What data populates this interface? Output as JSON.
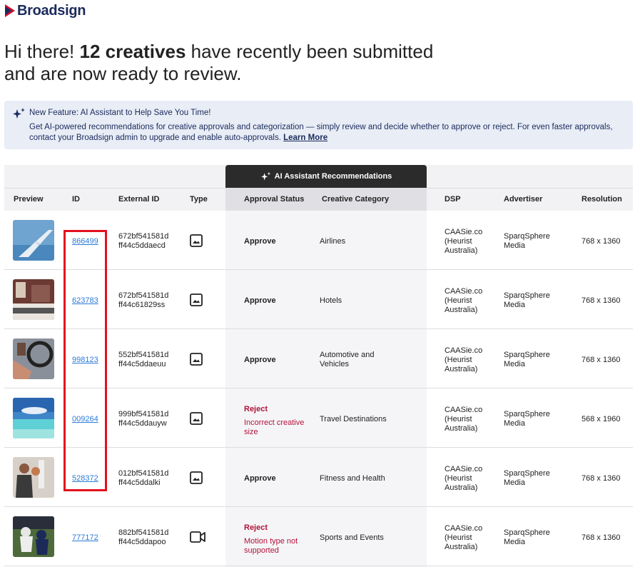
{
  "brand": {
    "name": "Broadsign"
  },
  "headline": {
    "prefix": "Hi there! ",
    "count": "12 creatives",
    "line1_suffix": " have recently been submitted",
    "line2": "and are now ready to review."
  },
  "banner": {
    "title": "New Feature: AI Assistant to Help Save You Time!",
    "body": "Get AI-powered recommendations for creative approvals and categorization — simply review and decide whether to approve or reject. For even faster approvals, contact your Broadsign admin to upgrade and enable auto-approvals.",
    "link": "Learn More"
  },
  "ai_header": "AI Assistant Recommendations",
  "columns": {
    "preview": "Preview",
    "id": "ID",
    "external_id": "External ID",
    "type": "Type",
    "approval_status": "Approval Status",
    "creative_category": "Creative Category",
    "dsp": "DSP",
    "advertiser": "Advertiser",
    "resolution": "Resolution"
  },
  "rows": [
    {
      "id": "866499",
      "ext1": "672bf541581d",
      "ext2": "ff44c5ddaecd",
      "type": "image",
      "status": "Approve",
      "reason": "",
      "category": "Airlines",
      "dsp1": "CAASie.co",
      "dsp2": "(Heurist",
      "dsp3": "Australia)",
      "adv1": "SparqSphere",
      "adv2": "Media",
      "res": "768 x 1360"
    },
    {
      "id": "623783",
      "ext1": "672bf541581d",
      "ext2": "ff44c61829ss",
      "type": "image",
      "status": "Approve",
      "reason": "",
      "category": "Hotels",
      "dsp1": "CAASie.co",
      "dsp2": "(Heurist",
      "dsp3": "Australia)",
      "adv1": "SparqSphere",
      "adv2": "Media",
      "res": "768 x 1360"
    },
    {
      "id": "998123",
      "ext1": "552bf541581d",
      "ext2": "ff44c5ddaeuu",
      "type": "image",
      "status": "Approve",
      "reason": "",
      "category": "Automotive and Vehicles",
      "dsp1": "CAASie.co",
      "dsp2": "(Heurist",
      "dsp3": "Australia)",
      "adv1": "SparqSphere",
      "adv2": "Media",
      "res": "768 x 1360"
    },
    {
      "id": "009264",
      "ext1": "999bf541581d",
      "ext2": "ff44c5ddauyw",
      "type": "image",
      "status": "Reject",
      "reason": "Incorrect creative size",
      "category": "Travel Destinations",
      "dsp1": "CAASie.co",
      "dsp2": "(Heurist",
      "dsp3": "Australia)",
      "adv1": "SparqSphere",
      "adv2": "Media",
      "res": "568 x 1960"
    },
    {
      "id": "528372",
      "ext1": "012bf541581d",
      "ext2": "ff44c5ddalki",
      "type": "image",
      "status": "Approve",
      "reason": "",
      "category": "Fitness and Health",
      "dsp1": "CAASie.co",
      "dsp2": "(Heurist",
      "dsp3": "Australia)",
      "adv1": "SparqSphere",
      "adv2": "Media",
      "res": "768 x 1360"
    },
    {
      "id": "777172",
      "ext1": "882bf541581d",
      "ext2": "ff44c5ddapoo",
      "type": "video",
      "status": "Reject",
      "reason": "Motion type not supported",
      "category": "Sports and Events",
      "dsp1": "CAASie.co",
      "dsp2": "(Heurist",
      "dsp3": "Australia)",
      "adv1": "SparqSphere",
      "adv2": "Media",
      "res": "768 x 1360"
    }
  ],
  "colors": {
    "brand": "#1b2a5c",
    "link": "#2a7ad9",
    "reject": "#b3123a",
    "highlight": "#e3101e",
    "banner_bg": "#e8edf6"
  }
}
